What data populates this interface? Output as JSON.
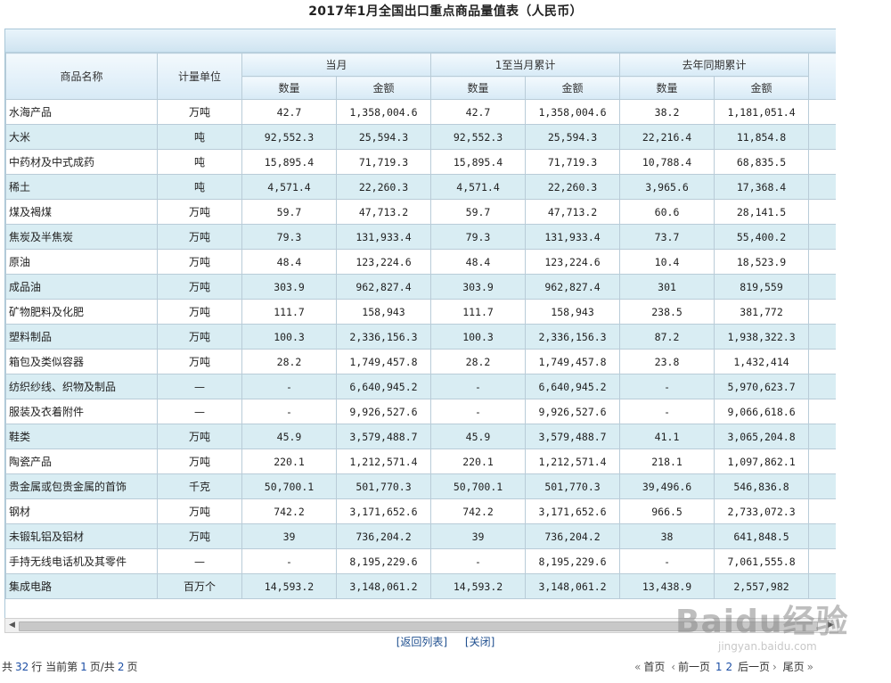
{
  "title": "2017年1月全国出口重点商品量值表（人民币）",
  "headers": {
    "name": "商品名称",
    "unit": "计量单位",
    "g1": "当月",
    "g2": "1至当月累计",
    "g3": "去年同期累计",
    "qty": "数量",
    "amt": "金额"
  },
  "rows": [
    {
      "name": "水海产品",
      "unit": "万吨",
      "q1": "42.7",
      "a1": "1,358,004.6",
      "q2": "42.7",
      "a2": "1,358,004.6",
      "q3": "38.2",
      "a3": "1,181,051.4"
    },
    {
      "name": "大米",
      "unit": "吨",
      "q1": "92,552.3",
      "a1": "25,594.3",
      "q2": "92,552.3",
      "a2": "25,594.3",
      "q3": "22,216.4",
      "a3": "11,854.8"
    },
    {
      "name": "中药材及中式成药",
      "unit": "吨",
      "q1": "15,895.4",
      "a1": "71,719.3",
      "q2": "15,895.4",
      "a2": "71,719.3",
      "q3": "10,788.4",
      "a3": "68,835.5"
    },
    {
      "name": "稀土",
      "unit": "吨",
      "q1": "4,571.4",
      "a1": "22,260.3",
      "q2": "4,571.4",
      "a2": "22,260.3",
      "q3": "3,965.6",
      "a3": "17,368.4"
    },
    {
      "name": "煤及褐煤",
      "unit": "万吨",
      "q1": "59.7",
      "a1": "47,713.2",
      "q2": "59.7",
      "a2": "47,713.2",
      "q3": "60.6",
      "a3": "28,141.5"
    },
    {
      "name": "焦炭及半焦炭",
      "unit": "万吨",
      "q1": "79.3",
      "a1": "131,933.4",
      "q2": "79.3",
      "a2": "131,933.4",
      "q3": "73.7",
      "a3": "55,400.2"
    },
    {
      "name": "原油",
      "unit": "万吨",
      "q1": "48.4",
      "a1": "123,224.6",
      "q2": "48.4",
      "a2": "123,224.6",
      "q3": "10.4",
      "a3": "18,523.9"
    },
    {
      "name": "成品油",
      "unit": "万吨",
      "q1": "303.9",
      "a1": "962,827.4",
      "q2": "303.9",
      "a2": "962,827.4",
      "q3": "301",
      "a3": "819,559"
    },
    {
      "name": "矿物肥料及化肥",
      "unit": "万吨",
      "q1": "111.7",
      "a1": "158,943",
      "q2": "111.7",
      "a2": "158,943",
      "q3": "238.5",
      "a3": "381,772"
    },
    {
      "name": "塑料制品",
      "unit": "万吨",
      "q1": "100.3",
      "a1": "2,336,156.3",
      "q2": "100.3",
      "a2": "2,336,156.3",
      "q3": "87.2",
      "a3": "1,938,322.3"
    },
    {
      "name": "箱包及类似容器",
      "unit": "万吨",
      "q1": "28.2",
      "a1": "1,749,457.8",
      "q2": "28.2",
      "a2": "1,749,457.8",
      "q3": "23.8",
      "a3": "1,432,414"
    },
    {
      "name": "纺织纱线、织物及制品",
      "unit": "—",
      "q1": "-",
      "a1": "6,640,945.2",
      "q2": "-",
      "a2": "6,640,945.2",
      "q3": "-",
      "a3": "5,970,623.7"
    },
    {
      "name": "服装及衣着附件",
      "unit": "—",
      "q1": "-",
      "a1": "9,926,527.6",
      "q2": "-",
      "a2": "9,926,527.6",
      "q3": "-",
      "a3": "9,066,618.6"
    },
    {
      "name": "鞋类",
      "unit": "万吨",
      "q1": "45.9",
      "a1": "3,579,488.7",
      "q2": "45.9",
      "a2": "3,579,488.7",
      "q3": "41.1",
      "a3": "3,065,204.8"
    },
    {
      "name": "陶瓷产品",
      "unit": "万吨",
      "q1": "220.1",
      "a1": "1,212,571.4",
      "q2": "220.1",
      "a2": "1,212,571.4",
      "q3": "218.1",
      "a3": "1,097,862.1"
    },
    {
      "name": "贵金属或包贵金属的首饰",
      "unit": "千克",
      "q1": "50,700.1",
      "a1": "501,770.3",
      "q2": "50,700.1",
      "a2": "501,770.3",
      "q3": "39,496.6",
      "a3": "546,836.8"
    },
    {
      "name": "钢材",
      "unit": "万吨",
      "q1": "742.2",
      "a1": "3,171,652.6",
      "q2": "742.2",
      "a2": "3,171,652.6",
      "q3": "966.5",
      "a3": "2,733,072.3"
    },
    {
      "name": "未锻轧铝及铝材",
      "unit": "万吨",
      "q1": "39",
      "a1": "736,204.2",
      "q2": "39",
      "a2": "736,204.2",
      "q3": "38",
      "a3": "641,848.5"
    },
    {
      "name": "手持无线电话机及其零件",
      "unit": "—",
      "q1": "-",
      "a1": "8,195,229.6",
      "q2": "-",
      "a2": "8,195,229.6",
      "q3": "-",
      "a3": "7,061,555.8"
    },
    {
      "name": "集成电路",
      "unit": "百万个",
      "q1": "14,593.2",
      "a1": "3,148,061.2",
      "q2": "14,593.2",
      "a2": "3,148,061.2",
      "q3": "13,438.9",
      "a3": "2,557,982"
    }
  ],
  "links": {
    "back": "[返回列表]",
    "close": "[关闭]"
  },
  "pager_info": {
    "prefix": "共",
    "total_rows": "32",
    "mid1": "行 当前第",
    "current_page": "1",
    "mid2": "页/共",
    "total_pages": "2",
    "suffix": "页"
  },
  "pager_nav": {
    "first": "首页",
    "prev": "前一页",
    "page1": "1",
    "page2": "2",
    "next": "后一页",
    "last": "尾页"
  },
  "watermark": {
    "main": "Baidu经验",
    "sub": "jingyan.baidu.com"
  }
}
